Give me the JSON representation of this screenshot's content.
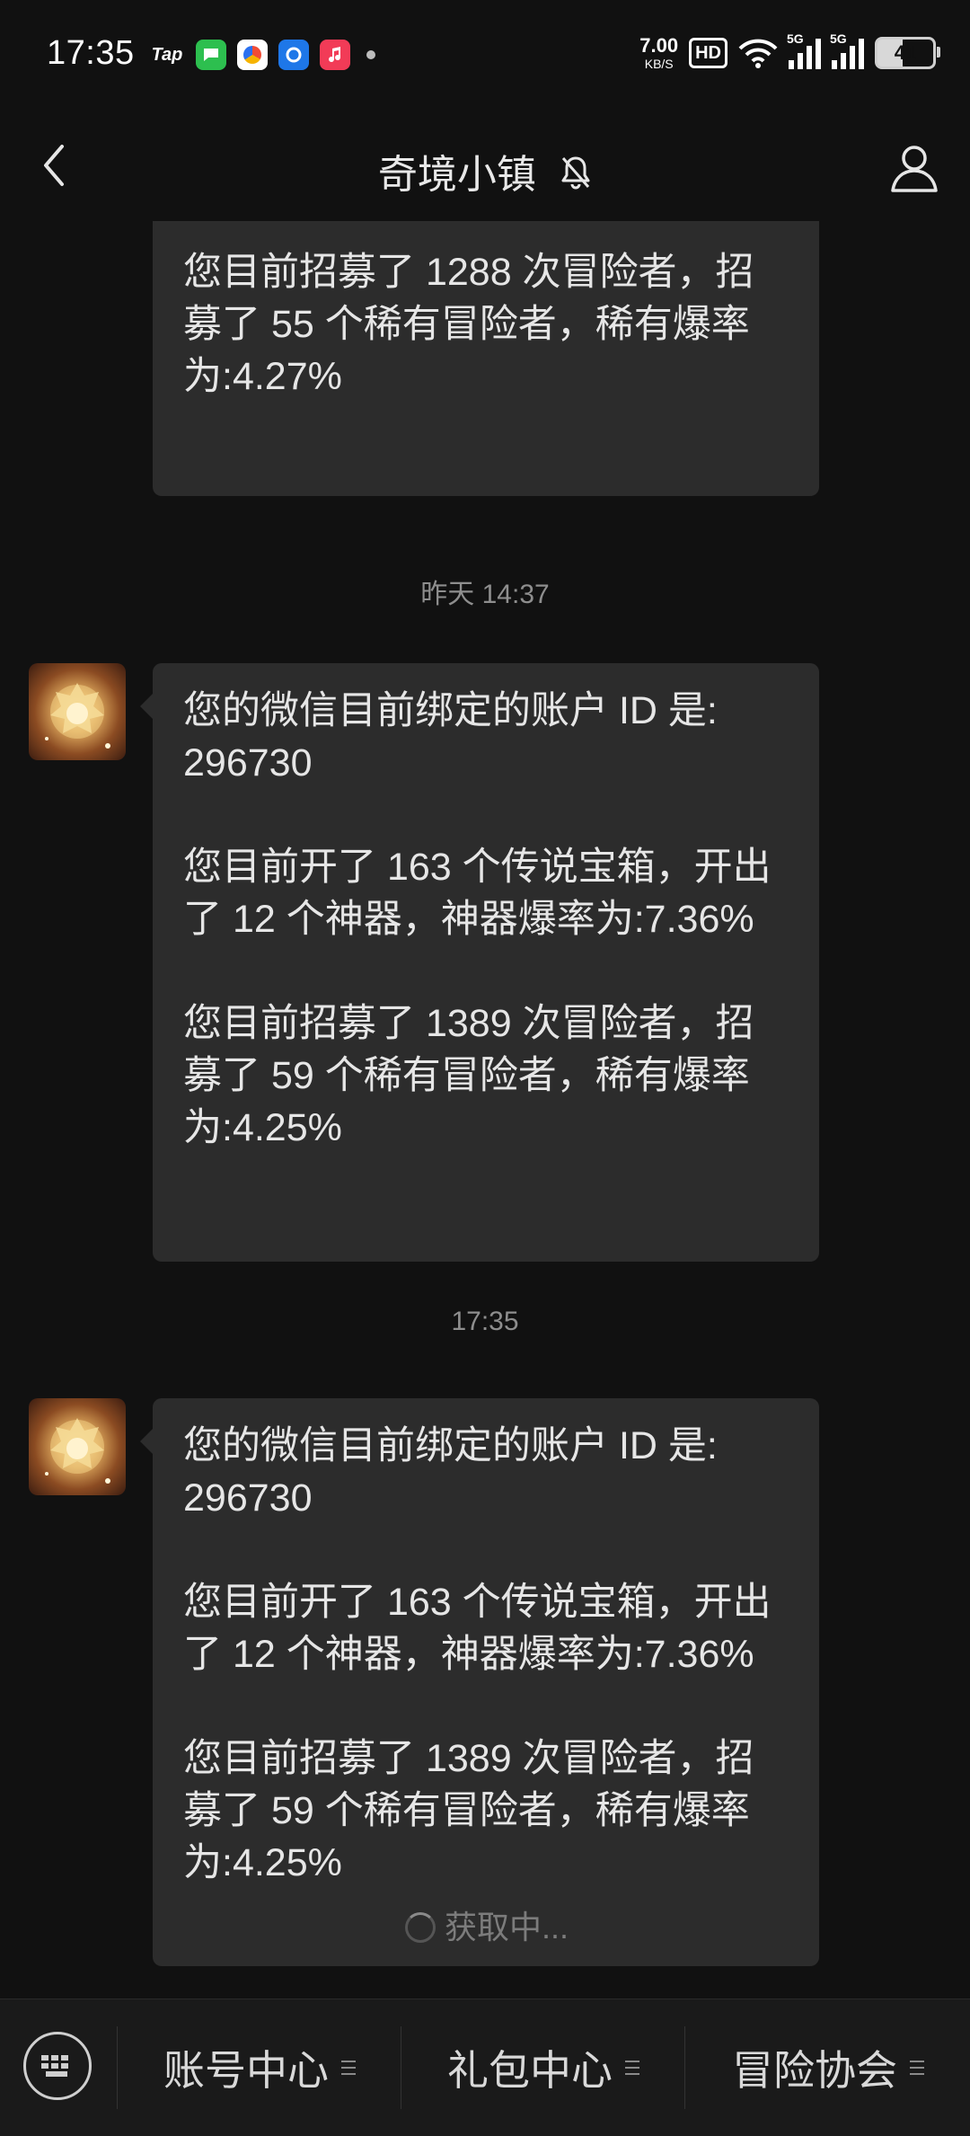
{
  "status_bar": {
    "time": "17:35",
    "apps": [
      "Tap"
    ],
    "net_speed_value": "7.00",
    "net_speed_unit": "KB/S",
    "hd_label": "HD",
    "sim1_label": "5G",
    "sim2_label": "5G",
    "battery": "41"
  },
  "header": {
    "title": "奇境小镇"
  },
  "messages": {
    "partial": {
      "p3": "您目前招募了 1288 次冒险者，招募了 55 个稀有冒险者，稀有爆率为:4.27%"
    },
    "ts1": "昨天 14:37",
    "msg1": {
      "p1": "您的微信目前绑定的账户 ID 是: 296730",
      "p2": "您目前开了 163 个传说宝箱，开出了 12 个神器，神器爆率为:7.36%",
      "p3": "您目前招募了 1389 次冒险者，招募了 59 个稀有冒险者，稀有爆率为:4.25%"
    },
    "ts2": "17:35",
    "msg2": {
      "p1": "您的微信目前绑定的账户 ID 是: 296730",
      "p2": "您目前开了 163 个传说宝箱，开出了 12 个神器，神器爆率为:7.36%",
      "p3": "您目前招募了 1389 次冒险者，招募了 59 个稀有冒险者，稀有爆率为:4.25%",
      "loading": "获取中..."
    }
  },
  "bottom_menu": {
    "items": [
      {
        "label": "账号中心"
      },
      {
        "label": "礼包中心"
      },
      {
        "label": "冒险协会"
      }
    ]
  }
}
